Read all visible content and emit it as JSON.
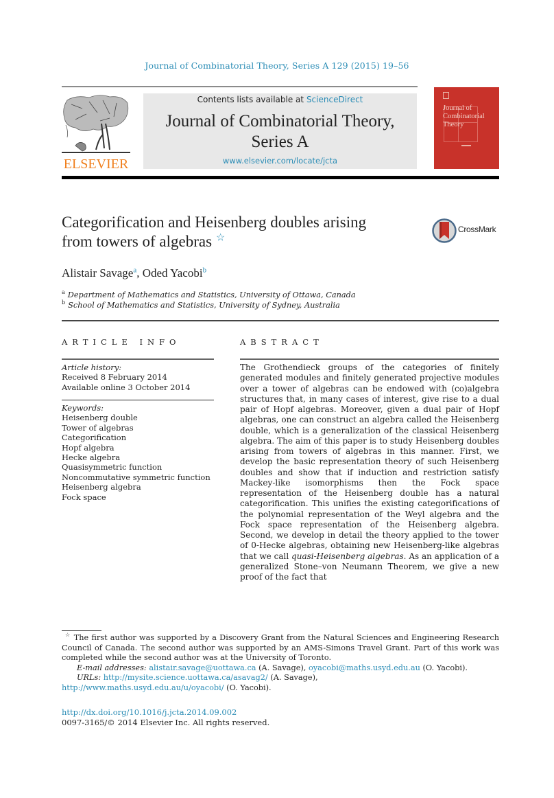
{
  "running_head": "Journal of Combinatorial Theory, Series A 129 (2015) 19–56",
  "masthead": {
    "publisher_logo_text": "ELSEVIER",
    "contents_prefix": "Contents lists available at ",
    "contents_link": "ScienceDirect",
    "journal_title_line1": "Journal of Combinatorial Theory,",
    "journal_title_line2": "Series A",
    "journal_url": "www.elsevier.com/locate/jcta",
    "cover": {
      "title_line1": "Journal of",
      "title_line2": "Combinatorial",
      "title_line3": "Theory",
      "color": "#c8322a"
    }
  },
  "article": {
    "title_line1": "Categorification and Heisenberg doubles arising",
    "title_line2": "from towers of algebras",
    "title_note_marker": "☆",
    "crossmark_label": "CrossMark",
    "authors": [
      {
        "name": "Alistair Savage",
        "affiliation": "a"
      },
      {
        "name": "Oded Yacobi",
        "affiliation": "b"
      }
    ],
    "author_separator": ", ",
    "affiliations": [
      {
        "letter": "a",
        "text": "Department of Mathematics and Statistics, University of Ottawa, Canada"
      },
      {
        "letter": "b",
        "text": "School of Mathematics and Statistics, University of Sydney, Australia"
      }
    ]
  },
  "article_info": {
    "label": "ARTICLE INFO",
    "history_heading": "Article history:",
    "history": [
      "Received 8 February 2014",
      "Available online 3 October 2014"
    ],
    "keywords_heading": "Keywords:",
    "keywords": [
      "Heisenberg double",
      "Tower of algebras",
      "Categorification",
      "Hopf algebra",
      "Hecke algebra",
      "Quasisymmetric function",
      "Noncommutative symmetric function",
      "Heisenberg algebra",
      "Fock space"
    ]
  },
  "abstract": {
    "label": "ABSTRACT",
    "text_part1": "The Grothendieck groups of the categories of finitely generated modules and finitely generated projective modules over a tower of algebras can be endowed with (co)algebra structures that, in many cases of interest, give rise to a dual pair of Hopf algebras. Moreover, given a dual pair of Hopf algebras, one can construct an algebra called the Heisenberg double, which is a generalization of the classical Heisenberg algebra. The aim of this paper is to study Heisenberg doubles arising from towers of algebras in this manner. First, we develop the basic representation theory of such Heisenberg doubles and show that if induction and restriction satisfy Mackey-like isomorphisms then the Fock space representation of the Heisenberg double has a natural categorification. This unifies the existing categorifications of the polynomial representation of the Weyl algebra and the Fock space representation of the Heisenberg algebra. Second, we develop in detail the theory applied to the tower of 0-Hecke algebras, obtaining new Heisenberg-like algebras that we call ",
    "text_italic": "quasi-Heisenberg algebras",
    "text_part2": ". As an application of a generalized Stone–von Neumann Theorem, we give a new proof of the fact that"
  },
  "footnotes": {
    "marker": "☆",
    "funding": "The first author was supported by a Discovery Grant from the Natural Sciences and Engineering Research Council of Canada. The second author was supported by an AMS-Simons Travel Grant. Part of this work was completed while the second author was at the University of Toronto.",
    "email_label": "E-mail addresses:",
    "emails": [
      {
        "address": "alistair.savage@uottawa.ca",
        "owner": "(A. Savage)"
      },
      {
        "address": "oyacobi@maths.usyd.edu.au",
        "owner": "(O. Yacobi)."
      }
    ],
    "urls_label": "URLs:",
    "urls": [
      {
        "url": "http://mysite.science.uottawa.ca/asavag2/",
        "owner": "(A. Savage),"
      },
      {
        "url": "http://www.maths.usyd.edu.au/u/oyacobi/",
        "owner": "(O. Yacobi)."
      }
    ]
  },
  "doi": "http://dx.doi.org/10.1016/j.jcta.2014.09.002",
  "copyright": "0097-3165/© 2014 Elsevier Inc. All rights reserved.",
  "colors": {
    "link": "#2a8cb5",
    "elsevier_orange": "#f07f1d",
    "masthead_bg": "#e8e8e8"
  }
}
